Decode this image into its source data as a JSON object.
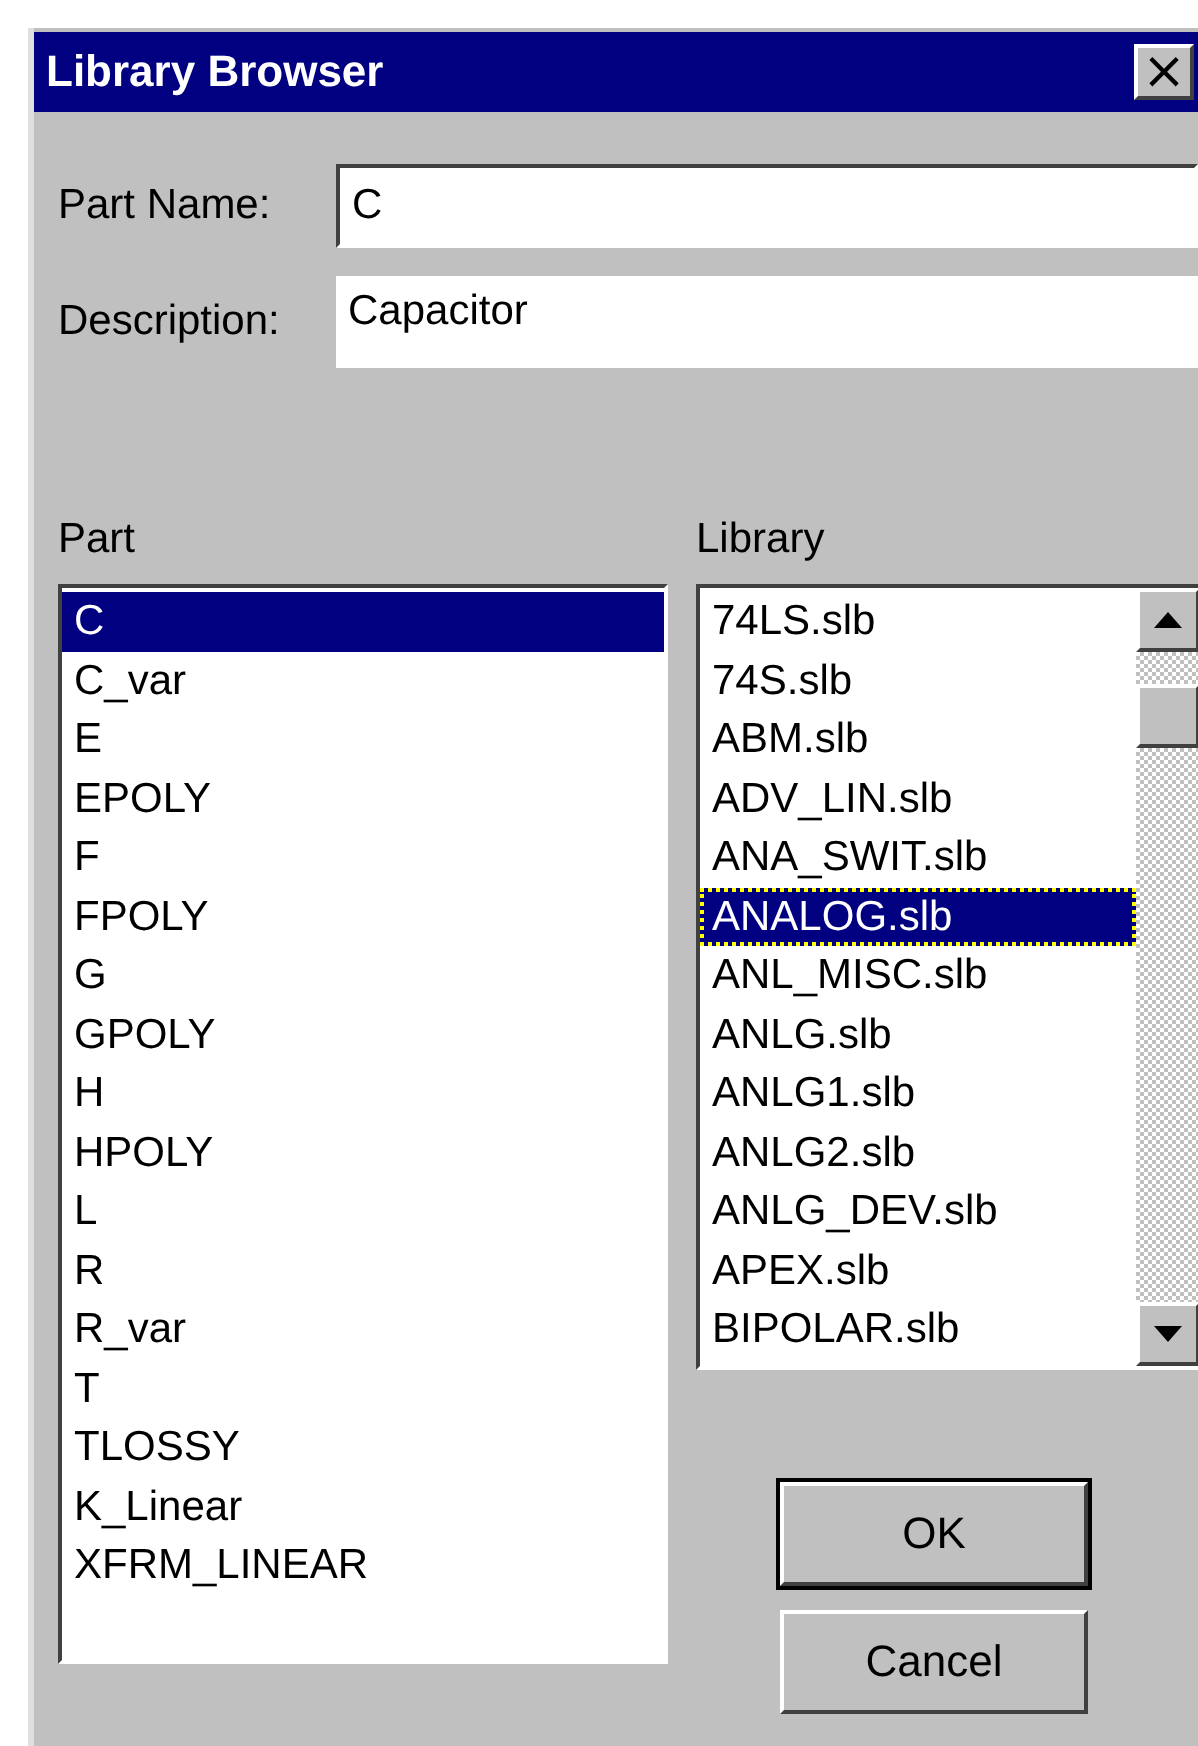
{
  "window": {
    "title": "Library Browser",
    "close": "×"
  },
  "fields": [
    {
      "label": "Part Name:",
      "value": "C",
      "kind": "input"
    },
    {
      "label": "Description:",
      "value": "Capacitor",
      "kind": "readonly"
    }
  ],
  "part_list": {
    "label": "Part",
    "items": [
      {
        "text": "C",
        "selected": true
      },
      {
        "text": "C_var",
        "selected": false
      },
      {
        "text": "E",
        "selected": false
      },
      {
        "text": "EPOLY",
        "selected": false
      },
      {
        "text": "F",
        "selected": false
      },
      {
        "text": "FPOLY",
        "selected": false
      },
      {
        "text": "G",
        "selected": false
      },
      {
        "text": "GPOLY",
        "selected": false
      },
      {
        "text": "H",
        "selected": false
      },
      {
        "text": "HPOLY",
        "selected": false
      },
      {
        "text": "L",
        "selected": false
      },
      {
        "text": "R",
        "selected": false
      },
      {
        "text": "R_var",
        "selected": false
      },
      {
        "text": "T",
        "selected": false
      },
      {
        "text": "TLOSSY",
        "selected": false
      },
      {
        "text": "K_Linear",
        "selected": false
      },
      {
        "text": "XFRM_LINEAR",
        "selected": false
      }
    ]
  },
  "library_list": {
    "label": "Library",
    "items": [
      {
        "text": "74LS.slb",
        "selected": false
      },
      {
        "text": "74S.slb",
        "selected": false
      },
      {
        "text": "ABM.slb",
        "selected": false
      },
      {
        "text": "ADV_LIN.slb",
        "selected": false
      },
      {
        "text": "ANA_SWIT.slb",
        "selected": false
      },
      {
        "text": "ANALOG.slb",
        "selected": true
      },
      {
        "text": "ANL_MISC.slb",
        "selected": false
      },
      {
        "text": "ANLG.slb",
        "selected": false
      },
      {
        "text": "ANLG1.slb",
        "selected": false
      },
      {
        "text": "ANLG2.slb",
        "selected": false
      },
      {
        "text": "ANLG_DEV.slb",
        "selected": false
      },
      {
        "text": "APEX.slb",
        "selected": false
      },
      {
        "text": "BIPOLAR.slb",
        "selected": false
      }
    ]
  },
  "buttons": [
    {
      "label": "OK",
      "default": true
    },
    {
      "label": "Cancel",
      "default": false
    }
  ]
}
